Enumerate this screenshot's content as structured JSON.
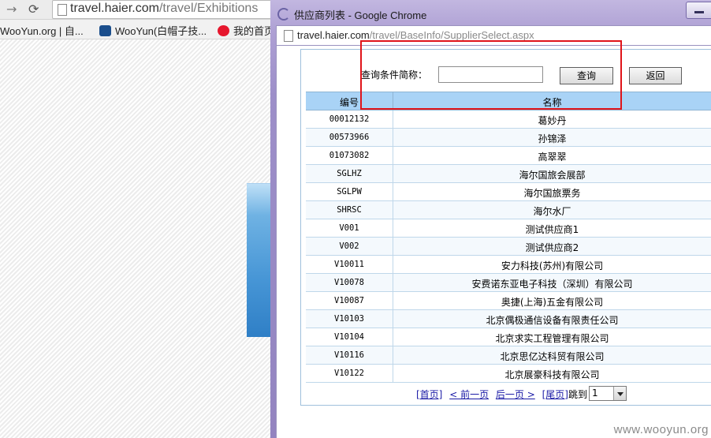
{
  "background_browser": {
    "url_host": "travel.haier.com",
    "url_path": "/travel/Exhibitions",
    "bookmarks": [
      "WooYun.org | 自...",
      "WooYun(白帽子技...",
      "我的首页"
    ]
  },
  "popup": {
    "window_title": "供应商列表 - Google Chrome",
    "url_host": "travel.haier.com",
    "url_path": "/travel/BaseInfo/SupplierSelect.aspx",
    "query": {
      "label": "查询条件简称：",
      "value": "",
      "search_button": "查询",
      "back_button": "返回"
    },
    "table": {
      "columns": [
        "编号",
        "名称"
      ],
      "rows": [
        {
          "id": "00012132",
          "name": "葛妙丹"
        },
        {
          "id": "00573966",
          "name": "孙锦泽"
        },
        {
          "id": "01073082",
          "name": "高翠翠"
        },
        {
          "id": "SGLHZ",
          "name": "海尔国旅会展部"
        },
        {
          "id": "SGLPW",
          "name": "海尔国旅票务"
        },
        {
          "id": "SHRSC",
          "name": "海尔水厂"
        },
        {
          "id": "V001",
          "name": "测试供应商1"
        },
        {
          "id": "V002",
          "name": "测试供应商2"
        },
        {
          "id": "V10011",
          "name": "安力科技(苏州)有限公司"
        },
        {
          "id": "V10078",
          "name": "安费诺东亚电子科技（深圳）有限公司"
        },
        {
          "id": "V10087",
          "name": "奥捷(上海)五金有限公司"
        },
        {
          "id": "V10103",
          "name": "北京偶极通信设备有限责任公司"
        },
        {
          "id": "V10104",
          "name": "北京求实工程管理有限公司"
        },
        {
          "id": "V10116",
          "name": "北京思亿达科贸有限公司"
        },
        {
          "id": "V10122",
          "name": "北京展豪科技有限公司"
        }
      ]
    },
    "pager": {
      "first": "[首页]",
      "prev": "< 前一页",
      "next": "后一页 >",
      "last": "[尾页]",
      "jump_label": "跳到",
      "page_value": "1"
    }
  },
  "watermark": "www.wooyun.org",
  "colors": {
    "table_header": "#a9d3f6",
    "highlight_border": "#e0141a",
    "popup_frame": "#aea0d4",
    "link": "#1a1aa6"
  },
  "icons": [
    "forward-arrow-icon",
    "reload-icon",
    "page-icon",
    "wooyun-icon",
    "weibo-icon",
    "loading-spinner-icon",
    "minimize-icon",
    "dropdown-arrow-icon"
  ]
}
